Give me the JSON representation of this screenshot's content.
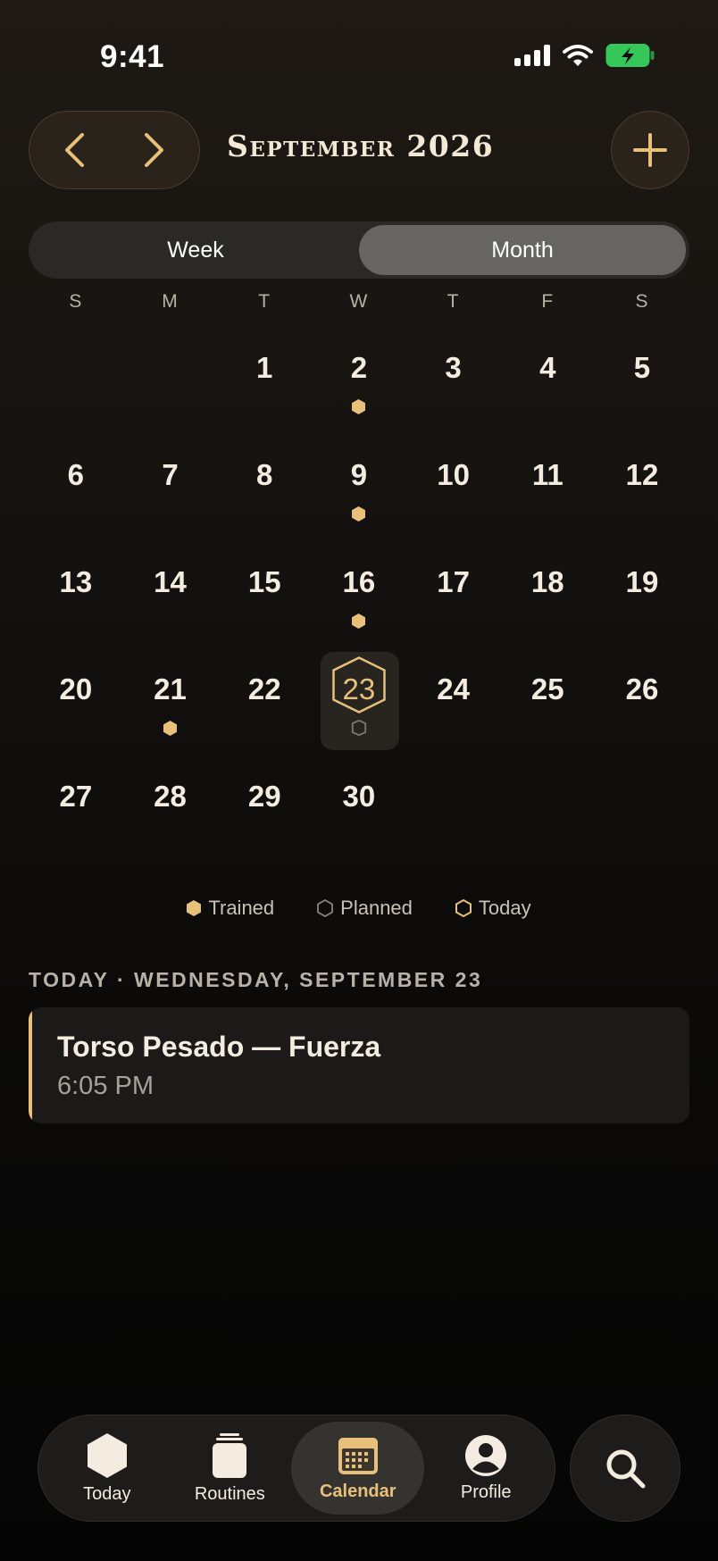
{
  "status_bar": {
    "time": "9:41"
  },
  "header": {
    "month_title": "September 2026"
  },
  "view_toggle": {
    "week_label": "Week",
    "month_label": "Month",
    "selected": "Month"
  },
  "calendar": {
    "weekday_headers": [
      "S",
      "M",
      "T",
      "W",
      "T",
      "F",
      "S"
    ],
    "weeks": [
      [
        null,
        null,
        {
          "day": "1"
        },
        {
          "day": "2",
          "marker": "trained"
        },
        {
          "day": "3"
        },
        {
          "day": "4"
        },
        {
          "day": "5"
        }
      ],
      [
        {
          "day": "6"
        },
        {
          "day": "7"
        },
        {
          "day": "8"
        },
        {
          "day": "9",
          "marker": "trained"
        },
        {
          "day": "10"
        },
        {
          "day": "11"
        },
        {
          "day": "12"
        }
      ],
      [
        {
          "day": "13"
        },
        {
          "day": "14"
        },
        {
          "day": "15"
        },
        {
          "day": "16",
          "marker": "trained"
        },
        {
          "day": "17"
        },
        {
          "day": "18"
        },
        {
          "day": "19"
        }
      ],
      [
        {
          "day": "20"
        },
        {
          "day": "21",
          "marker": "trained"
        },
        {
          "day": "22"
        },
        {
          "day": "23",
          "marker": "planned",
          "today": true
        },
        {
          "day": "24"
        },
        {
          "day": "25"
        },
        {
          "day": "26"
        }
      ],
      [
        {
          "day": "27"
        },
        {
          "day": "28"
        },
        {
          "day": "29"
        },
        {
          "day": "30"
        },
        null,
        null,
        null
      ]
    ]
  },
  "legend": {
    "trained": "Trained",
    "planned": "Planned",
    "today": "Today"
  },
  "today_section": {
    "label": "TODAY · WEDNESDAY, SEPTEMBER 23",
    "event": {
      "title": "Torso Pesado — Fuerza",
      "time": "6:05 PM"
    }
  },
  "tabbar": {
    "tabs": [
      {
        "label": "Today",
        "icon": "hexagon-icon"
      },
      {
        "label": "Routines",
        "icon": "routines-icon"
      },
      {
        "label": "Calendar",
        "icon": "calendar-icon",
        "active": true
      },
      {
        "label": "Profile",
        "icon": "profile-icon"
      }
    ],
    "search_icon": "search-icon"
  },
  "colors": {
    "accent": "#e8c07a",
    "text": "#f4ece0",
    "muted": "#b9b1a6",
    "battery": "#35c759"
  }
}
